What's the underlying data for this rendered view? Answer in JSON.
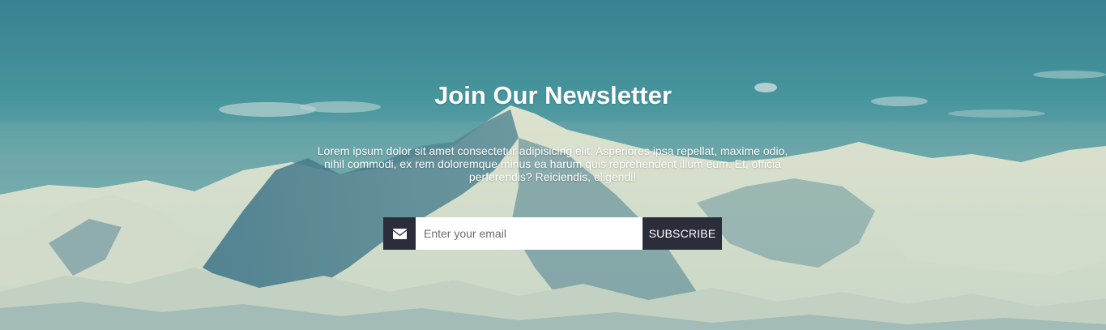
{
  "newsletter": {
    "title": "Join Our Newsletter",
    "description": "Lorem ipsum dolor sit amet consectetur adipisicing elit. Asperiores ipsa repellat, maxime odio, nihil commodi, ex rem doloremque minus ea harum quis reprehendent illum eum. Et, officia perferendis? Reiciendis, eligendi!",
    "email_placeholder": "Enter your email",
    "email_value": "",
    "subscribe_label": "SUBSCRIBE"
  },
  "icons": {
    "mail": "envelope-icon"
  },
  "colors": {
    "button_bg": "#2c2d3a",
    "text": "#ffffff",
    "sky": "#3c8593",
    "snow": "#f3f0d6"
  }
}
